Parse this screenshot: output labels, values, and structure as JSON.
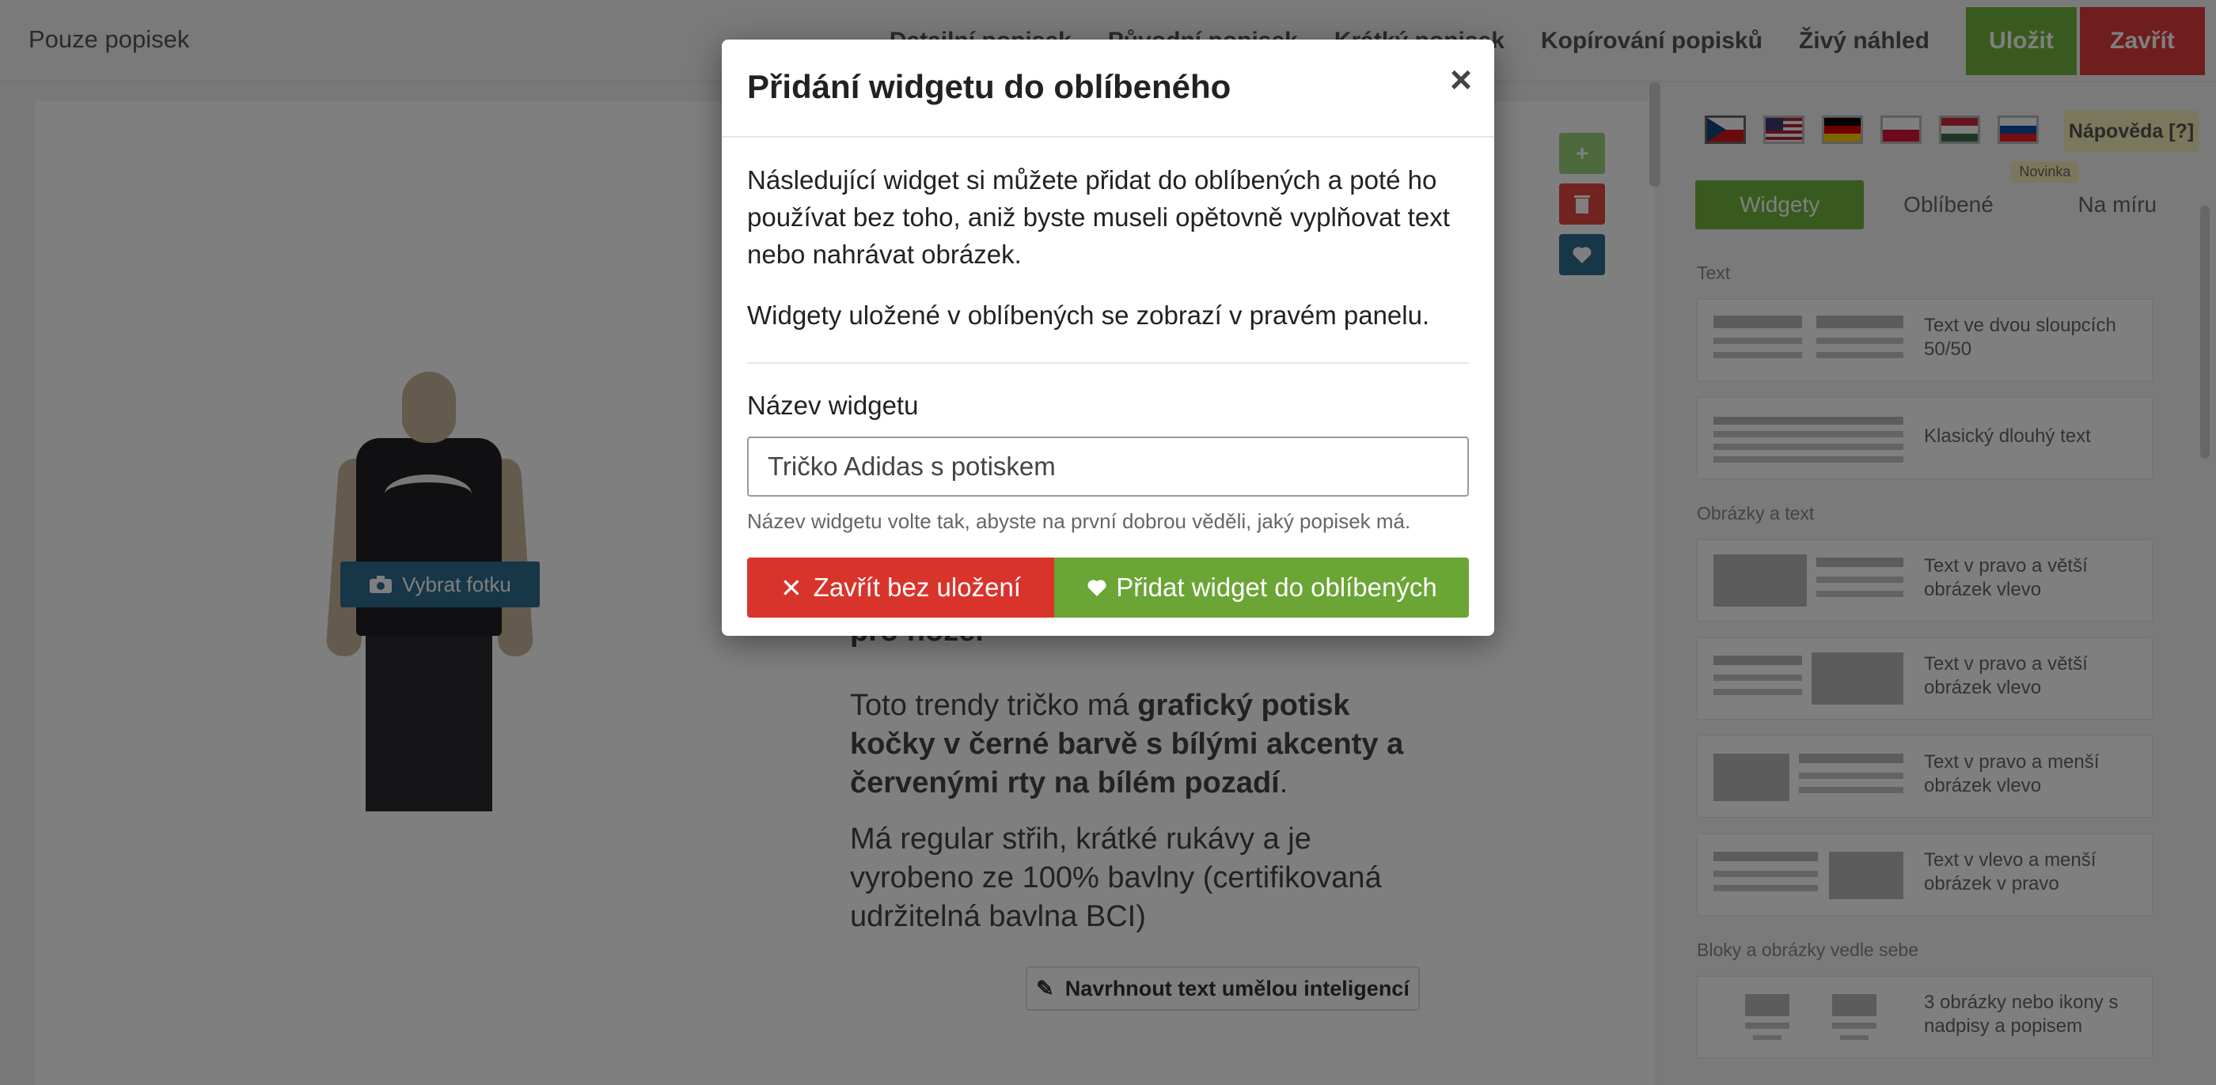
{
  "header": {
    "brand": "Pouze popisek",
    "nav": [
      "Detailní popisek",
      "Původní popisek",
      "Krátký popisek",
      "Kopírování popisků",
      "Živý náhled"
    ],
    "save_label": "Uložit",
    "close_label": "Zavřít"
  },
  "editor": {
    "photo_button": "Vybrat fotku",
    "text_fragment": "pro ňože.",
    "paragraph1_pre": "Toto trendy tričko má ",
    "paragraph1_bold": "grafický potisk kočky v černé barvě s bílými akcenty a červenými rty na bílém pozadí",
    "paragraph1_post": ".",
    "paragraph2": "Má regular střih, krátké rukávy a je vyrobeno ze 100% bavlny (certifikovaná udržitelná bavlna BCI)",
    "ai_button": "Navrhnout text umělou inteligencí"
  },
  "right_panel": {
    "help": "Nápověda [?]",
    "tabs": [
      "Widgety",
      "Oblíbené",
      "Na míru"
    ],
    "badge": "Novinka",
    "sections": [
      "Text",
      "Obrázky a text",
      "Bloky a obrázky vedle sebe"
    ],
    "cards": [
      "Text ve dvou sloupcích 50/50",
      "Klasický dlouhý text",
      "Text v pravo a větší obrázek vlevo",
      "Text v pravo a větší obrázek vlevo",
      "Text v pravo a menší obrázek vlevo",
      "Text v vlevo a menší obrázek v pravo",
      "3 obrázky nebo ikony s nadpisy a popisem"
    ]
  },
  "modal": {
    "title": "Přidání widgetu do oblíbeného",
    "close_symbol": "×",
    "text1": "Následující widget si můžete přidat do oblíbených a poté ho používat bez toho, aniž byste museli opětovně vyplňovat text nebo nahrávat obrázek.",
    "text2": "Widgety uložené v oblíbených se zobrazí v pravém panelu.",
    "field_label": "Název widgetu",
    "field_value": "Tričko Adidas s potiskem",
    "hint": "Název widgetu volte tak, abyste na první dobrou věděli, jaký popisek má.",
    "cancel_label": "Zavřít bez uložení",
    "confirm_label": "Přidat widget do oblíbených"
  },
  "colors": {
    "green": "#72b43c",
    "red": "#d9342b",
    "blue": "#2e6c8e"
  }
}
